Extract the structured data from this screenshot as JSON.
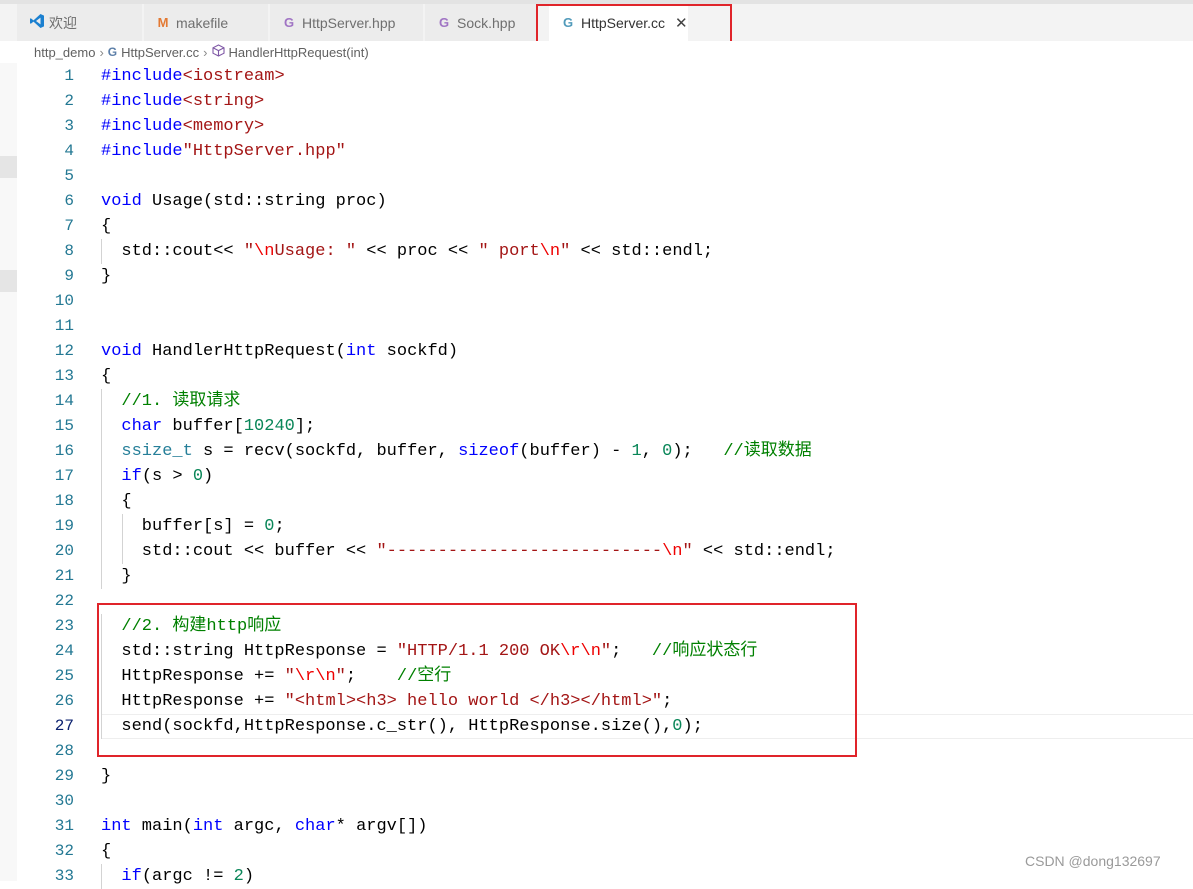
{
  "tabs": [
    {
      "label": "欢迎",
      "icon": "vscode-logo-icon"
    },
    {
      "label": "makefile",
      "icon": "makefile-icon"
    },
    {
      "label": "HttpServer.hpp",
      "icon": "cpp-header-file-icon"
    },
    {
      "label": "Sock.hpp",
      "icon": "cpp-header-file-icon"
    },
    {
      "label": "HttpServer.cc",
      "icon": "cpp-file-icon",
      "active": true
    }
  ],
  "breadcrumb": {
    "folder": "http_demo",
    "file": "HttpServer.cc",
    "symbol": "HandlerHttpRequest(int)"
  },
  "editor": {
    "current_line": 27,
    "lines": [
      {
        "n": 1,
        "text": "#include<iostream>"
      },
      {
        "n": 2,
        "text": "#include<string>"
      },
      {
        "n": 3,
        "text": "#include<memory>"
      },
      {
        "n": 4,
        "text": "#include\"HttpServer.hpp\""
      },
      {
        "n": 5,
        "text": ""
      },
      {
        "n": 6,
        "text": "void Usage(std::string proc)"
      },
      {
        "n": 7,
        "text": "{"
      },
      {
        "n": 8,
        "text": "  std::cout<< \"\\nUsage: \" << proc << \" port\\n\" << std::endl;"
      },
      {
        "n": 9,
        "text": "}"
      },
      {
        "n": 10,
        "text": ""
      },
      {
        "n": 11,
        "text": ""
      },
      {
        "n": 12,
        "text": "void HandlerHttpRequest(int sockfd)"
      },
      {
        "n": 13,
        "text": "{"
      },
      {
        "n": 14,
        "text": "  //1. 读取请求"
      },
      {
        "n": 15,
        "text": "  char buffer[10240];"
      },
      {
        "n": 16,
        "text": "  ssize_t s = recv(sockfd, buffer, sizeof(buffer) - 1, 0);   //读取数据"
      },
      {
        "n": 17,
        "text": "  if(s > 0)"
      },
      {
        "n": 18,
        "text": "  {"
      },
      {
        "n": 19,
        "text": "    buffer[s] = 0;"
      },
      {
        "n": 20,
        "text": "    std::cout << buffer << \"---------------------------\\n\" << std::endl;"
      },
      {
        "n": 21,
        "text": "  }"
      },
      {
        "n": 22,
        "text": ""
      },
      {
        "n": 23,
        "text": "  //2. 构建http响应"
      },
      {
        "n": 24,
        "text": "  std::string HttpResponse = \"HTTP/1.1 200 OK\\r\\n\";   //响应状态行"
      },
      {
        "n": 25,
        "text": "  HttpResponse += \"\\r\\n\";    //空行"
      },
      {
        "n": 26,
        "text": "  HttpResponse += \"<html><h3> hello world </h3></html>\";"
      },
      {
        "n": 27,
        "text": "  send(sockfd,HttpResponse.c_str(), HttpResponse.size(),0);"
      },
      {
        "n": 28,
        "text": ""
      },
      {
        "n": 29,
        "text": "}"
      },
      {
        "n": 30,
        "text": ""
      },
      {
        "n": 31,
        "text": "int main(int argc, char* argv[])"
      },
      {
        "n": 32,
        "text": "{"
      },
      {
        "n": 33,
        "text": "  if(argc != 2)"
      }
    ]
  },
  "watermark": "CSDN @dong132697",
  "colors": {
    "highlight_box": "#e0242a",
    "keyword": "#0000ff",
    "type": "#267f99",
    "string": "#a31515",
    "number": "#098658",
    "comment": "#008000",
    "line_number": "#237893"
  }
}
